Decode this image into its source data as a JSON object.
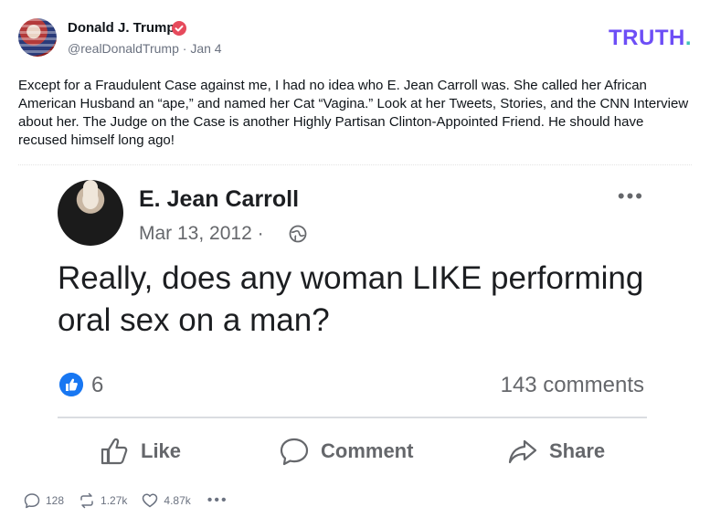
{
  "post": {
    "author_name": "Donald J. Trump",
    "handle": "@realDonaldTrump",
    "date": "Jan 4",
    "meta_separator": "·",
    "brand": "TRUTH",
    "brand_dot": ".",
    "text": "Except for a Fraudulent Case against me, I had no idea who E. Jean Carroll was. She called her African American Husband an “ape,” and named her Cat “Vagina.” Look at her Tweets, Stories, and the CNN Interview about her. The Judge on the Case is another Highly Partisan Clinton-Appointed Friend. He should have recused himself long ago!"
  },
  "embed": {
    "name": "E. Jean Carroll",
    "date": "Mar 13, 2012",
    "date_separator": "·",
    "more": "•••",
    "text": "Really, does any woman LIKE performing oral sex on a man?",
    "likes": "6",
    "comments": "143 comments",
    "actions": {
      "like": "Like",
      "comment": "Comment",
      "share": "Share"
    }
  },
  "stats": {
    "replies": "128",
    "retruths": "1.27k",
    "likes": "4.87k",
    "more": "•••"
  },
  "colors": {
    "brand": "#6d4ef6",
    "brand_dot": "#3ec3b9",
    "verified": "#e64a5c",
    "facebook_blue": "#1877f2"
  }
}
